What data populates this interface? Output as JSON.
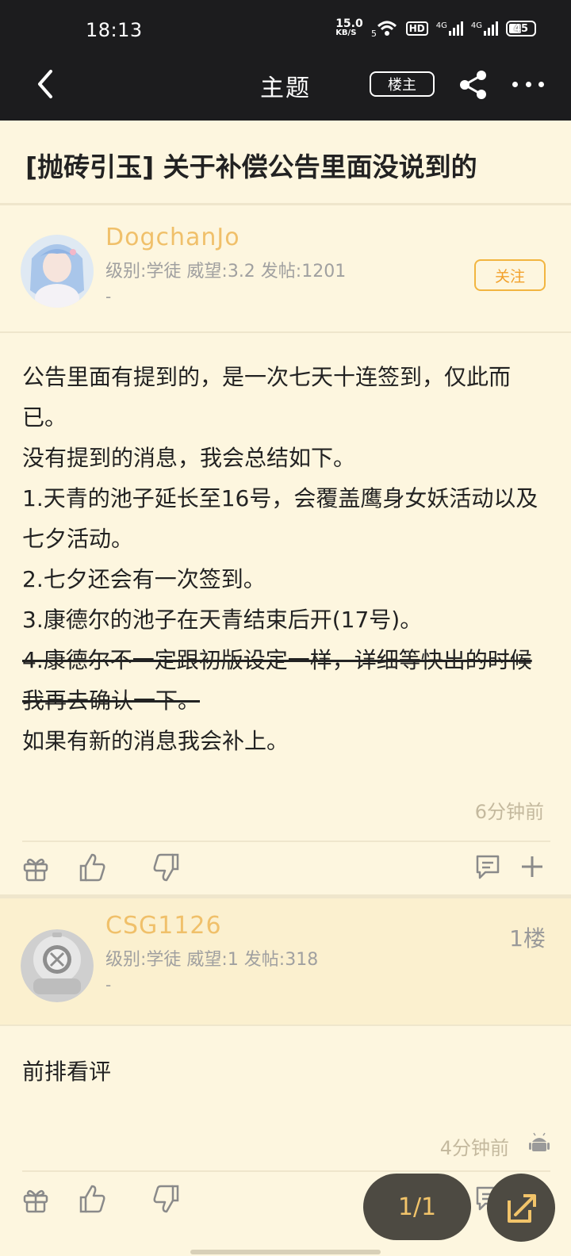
{
  "status_bar": {
    "time": "18:13",
    "net_speed_value": "15.0",
    "net_speed_unit": "KB/S",
    "hd_label": "HD",
    "signal1_label": "4G",
    "signal2_label": "4G",
    "battery": "45"
  },
  "nav": {
    "title": "主题",
    "owner_button": "楼主"
  },
  "thread": {
    "title": "[抛砖引玉] 关于补偿公告里面没说到的"
  },
  "post": {
    "author": "DogchanJo",
    "meta": "级别:学徒 威望:3.2 发帖:1201",
    "meta_extra": "-",
    "follow_label": "关注",
    "lines": [
      "公告里面有提到的，是一次七天十连签到，仅此而已。",
      "没有提到的消息，我会总结如下。",
      "1.天青的池子延长至16号，会覆盖鹰身女妖活动以及七夕活动。",
      "2.七夕还会有一次签到。",
      "3.康德尔的池子在天青结束后开(17号)。"
    ],
    "strike_line": "4.康德尔不一定跟初版设定一样，详细等快出的时候我再去确认一下。",
    "last_line": "如果有新的消息我会补上。",
    "time": "6分钟前"
  },
  "reply": {
    "author": "CSG1126",
    "meta": "级别:学徒 威望:1 发帖:318",
    "meta_extra": "-",
    "floor": "1楼",
    "body": "前排看评",
    "time": "4分钟前"
  },
  "pager": {
    "label": "1/1"
  }
}
